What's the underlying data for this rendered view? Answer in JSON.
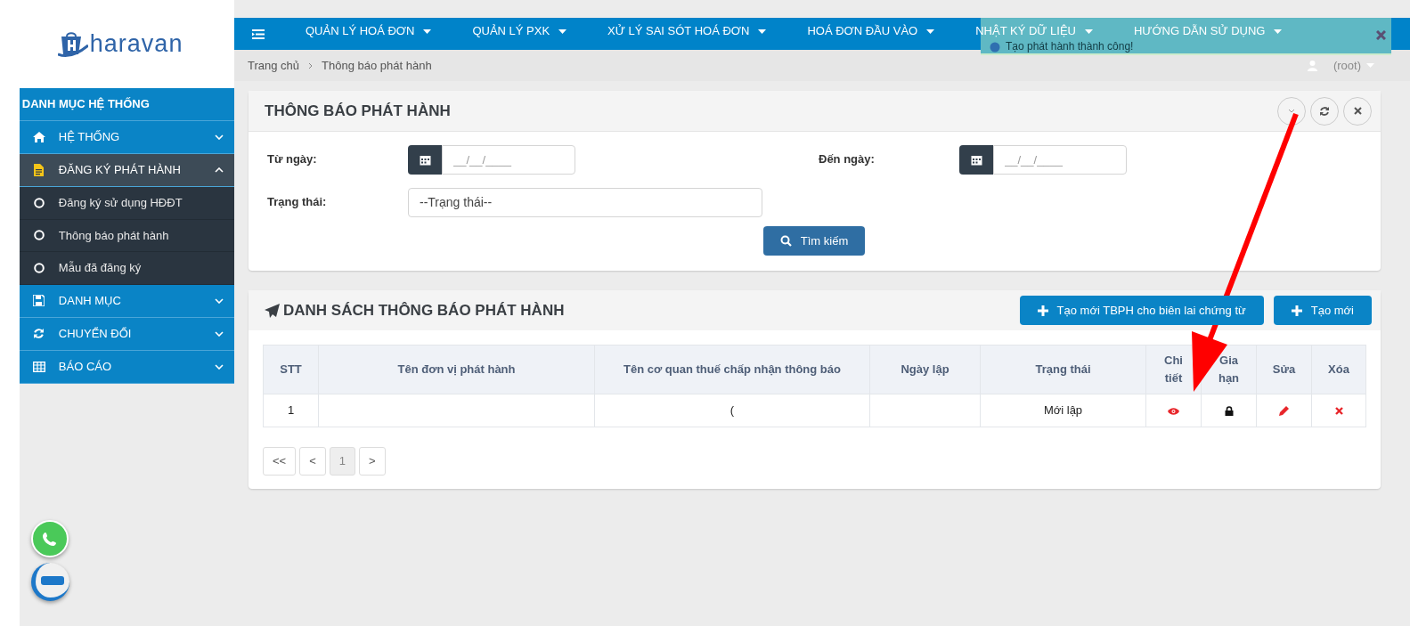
{
  "logo": {
    "text": "haravan"
  },
  "nav": {
    "items": [
      {
        "label": "QUẢN LÝ HOÁ ĐƠN"
      },
      {
        "label": "QUẢN LÝ PXK"
      },
      {
        "label": "XỬ LÝ SAI SÓT HOÁ ĐƠN"
      },
      {
        "label": "HOÁ ĐƠN ĐẦU VÀO"
      },
      {
        "label": "NHẬT KÝ DỮ LIỆU"
      },
      {
        "label": "HƯỚNG DẪN SỬ DỤNG"
      }
    ]
  },
  "toast": {
    "message": "Tạo phát hành thành công!"
  },
  "breadcrumb": [
    "Trang chủ",
    "Thông báo phát hành"
  ],
  "user": {
    "name": "(root)"
  },
  "sidebar": {
    "title": "DANH MỤC HỆ THỐNG",
    "items": [
      {
        "label": "HỆ THỐNG",
        "expanded": false
      },
      {
        "label": "ĐĂNG KÝ PHÁT HÀNH",
        "expanded": true,
        "children": [
          {
            "label": "Đăng ký sử dụng HĐĐT"
          },
          {
            "label": "Thông báo phát hành"
          },
          {
            "label": "Mẫu đã đăng ký"
          }
        ]
      },
      {
        "label": "DANH MỤC",
        "expanded": false
      },
      {
        "label": "CHUYỂN ĐỔI",
        "expanded": false
      },
      {
        "label": "BÁO CÁO",
        "expanded": false
      }
    ]
  },
  "filter_panel": {
    "title": "THÔNG BÁO PHÁT HÀNH",
    "from_date": {
      "label": "Từ ngày:",
      "placeholder": "__/__/____"
    },
    "to_date": {
      "label": "Đến ngày:",
      "placeholder": "__/__/____"
    },
    "status": {
      "label": "Trạng thái:",
      "placeholder": "--Trạng thái--"
    },
    "search_button": "Tìm kiếm"
  },
  "list_panel": {
    "title": "DANH SÁCH THÔNG BÁO PHÁT HÀNH",
    "buttons": [
      "Tạo mới TBPH cho biên lai chứng từ",
      "Tạo mới"
    ],
    "table": {
      "columns": [
        "STT",
        "Tên đơn vị phát hành",
        "Tên cơ quan thuế chấp nhận thông báo",
        "Ngày lập",
        "Trạng thái",
        "Chi tiết",
        "Gia hạn",
        "Sửa",
        "Xóa"
      ],
      "rows": [
        {
          "stt": "1",
          "column_3": "(",
          "status": "Mới lập"
        }
      ]
    },
    "pagination": [
      {
        "label": "<<",
        "selected": false
      },
      {
        "label": "<",
        "selected": false
      },
      {
        "label": "1",
        "selected": true
      },
      {
        "label": ">",
        "selected": false
      }
    ]
  }
}
